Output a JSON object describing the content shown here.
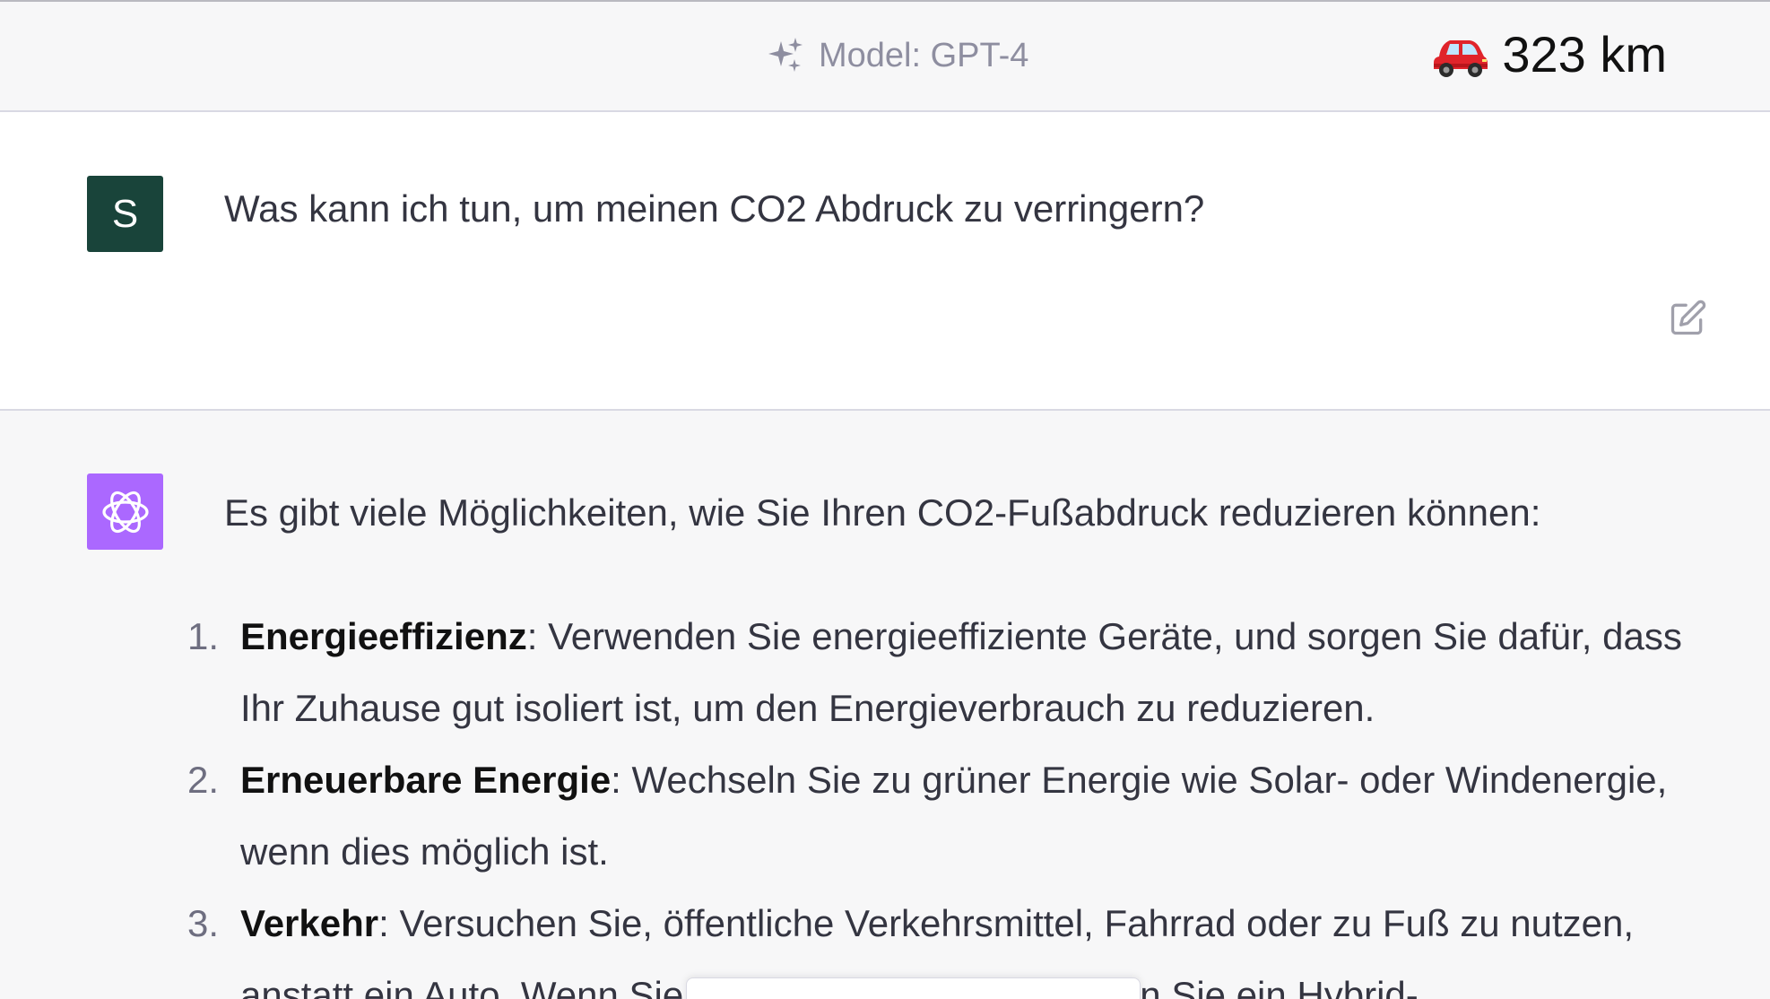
{
  "header": {
    "model_label": "Model: GPT-4",
    "sparkle_icon": "sparkle-icon",
    "distance_icon": "car-icon",
    "distance_text": "323 km"
  },
  "user_message": {
    "avatar_letter": "S",
    "avatar_color": "#19443a",
    "text": "Was kann ich tun, um meinen CO2 Abdruck zu verringern?",
    "edit_icon": "edit-icon"
  },
  "assistant_message": {
    "avatar_icon": "openai-logo-icon",
    "avatar_color": "#ab68ff",
    "intro": "Es gibt viele Möglichkeiten, wie Sie Ihren CO2-Fußabdruck reduzieren können:",
    "items": [
      {
        "number": "1.",
        "term": "Energieeffizienz",
        "text": ": Verwenden Sie energieeffiziente Geräte, und sorgen Sie dafür, dass Ihr Zuhause gut isoliert ist, um den Energieverbrauch zu reduzieren."
      },
      {
        "number": "2.",
        "term": "Erneuerbare Energie",
        "text": ": Wechseln Sie zu grüner Energie wie Solar- oder Windenergie, wenn dies möglich ist."
      },
      {
        "number": "3.",
        "term": "Verkehr",
        "text": ": Versuchen Sie, öffentliche Verkehrsmittel, Fahrrad oder zu Fuß zu nutzen, anstatt ein Auto. Wenn Sie ein Auto benötigen, könnten Sie ein Hybrid-"
      }
    ]
  }
}
